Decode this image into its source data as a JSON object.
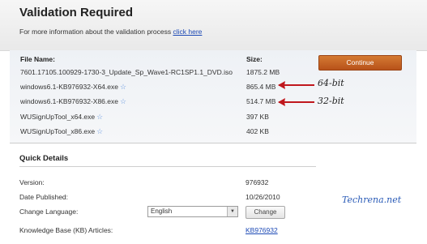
{
  "header": {
    "title": "Validation Required",
    "info_text": "For more information about the validation process",
    "info_link": "click here"
  },
  "files": {
    "col_name": "File Name:",
    "col_size": "Size:",
    "continue_label": "Continue",
    "star_icon": "star-icon",
    "rows": [
      {
        "name": "7601.17105.100929-1730-3_Update_Sp_Wave1-RC1SP1.1_DVD.iso",
        "size": "1875.2 MB"
      },
      {
        "name": "windows6.1-KB976932-X64.exe",
        "size": "865.4 MB"
      },
      {
        "name": "windows6.1-KB976932-X86.exe",
        "size": "514.7 MB"
      },
      {
        "name": "WUSignUpTool_x64.exe",
        "size": "397 KB"
      },
      {
        "name": "WUSignUpTool_x86.exe",
        "size": "402 KB"
      }
    ]
  },
  "annotations": {
    "x64_label": "64-bit",
    "x86_label": "32-bit",
    "arrow_color": "#c0171d"
  },
  "quick_details": {
    "title": "Quick Details",
    "version_label": "Version:",
    "version_value": "976932",
    "date_label": "Date Published:",
    "date_value": "10/26/2010",
    "language_label": "Change Language:",
    "language_selected": "English",
    "change_label": "Change",
    "kb_label": "Knowledge Base (KB) Articles:",
    "kb_value": "KB976932"
  },
  "watermark": "Techrena.net",
  "colors": {
    "link": "#1c49b5",
    "button": "#c8651f",
    "watermark": "#2a5bb7"
  }
}
